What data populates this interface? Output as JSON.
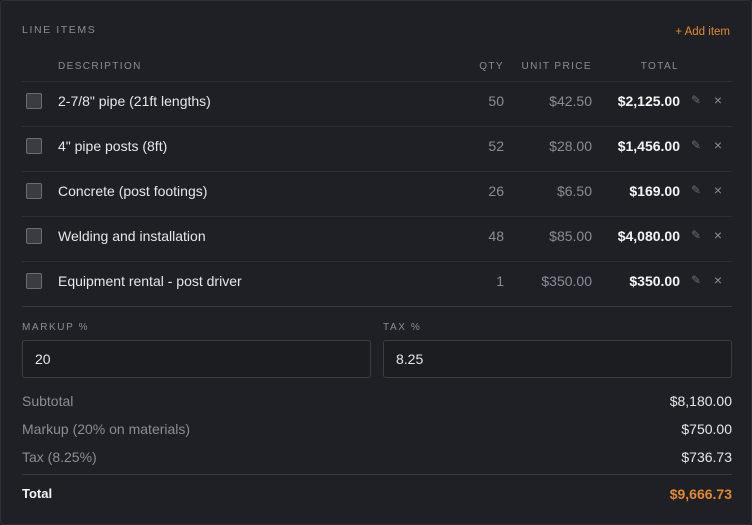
{
  "section": {
    "title": "LINE ITEMS",
    "add_label": "+ Add item"
  },
  "columns": {
    "description": "DESCRIPTION",
    "qty": "QTY",
    "unit_price": "UNIT PRICE",
    "total": "TOTAL"
  },
  "items": [
    {
      "description": "2-7/8\" pipe (21ft lengths)",
      "qty": "50",
      "unit_price": "$42.50",
      "total": "$2,125.00"
    },
    {
      "description": "4\" pipe posts (8ft)",
      "qty": "52",
      "unit_price": "$28.00",
      "total": "$1,456.00"
    },
    {
      "description": "Concrete (post footings)",
      "qty": "26",
      "unit_price": "$6.50",
      "total": "$169.00"
    },
    {
      "description": "Welding and installation",
      "qty": "48",
      "unit_price": "$85.00",
      "total": "$4,080.00"
    },
    {
      "description": "Equipment rental - post driver",
      "qty": "1",
      "unit_price": "$350.00",
      "total": "$350.00"
    }
  ],
  "icons": {
    "edit": "pencil-icon",
    "remove": "close-icon",
    "edit_glyph": "✎",
    "remove_glyph": "×"
  },
  "markup": {
    "label": "MARKUP %",
    "value": "20"
  },
  "tax": {
    "label": "TAX %",
    "value": "8.25"
  },
  "summary": {
    "subtotal_label": "Subtotal",
    "subtotal_value": "$8,180.00",
    "markup_label": "Markup (20% on materials)",
    "markup_value": "$750.00",
    "tax_label": "Tax (8.25%)",
    "tax_value": "$736.73",
    "total_label": "Total",
    "total_value": "$9,666.73"
  },
  "colors": {
    "accent": "#e08a2c",
    "background": "#1e2026",
    "muted": "#8a8d96"
  }
}
